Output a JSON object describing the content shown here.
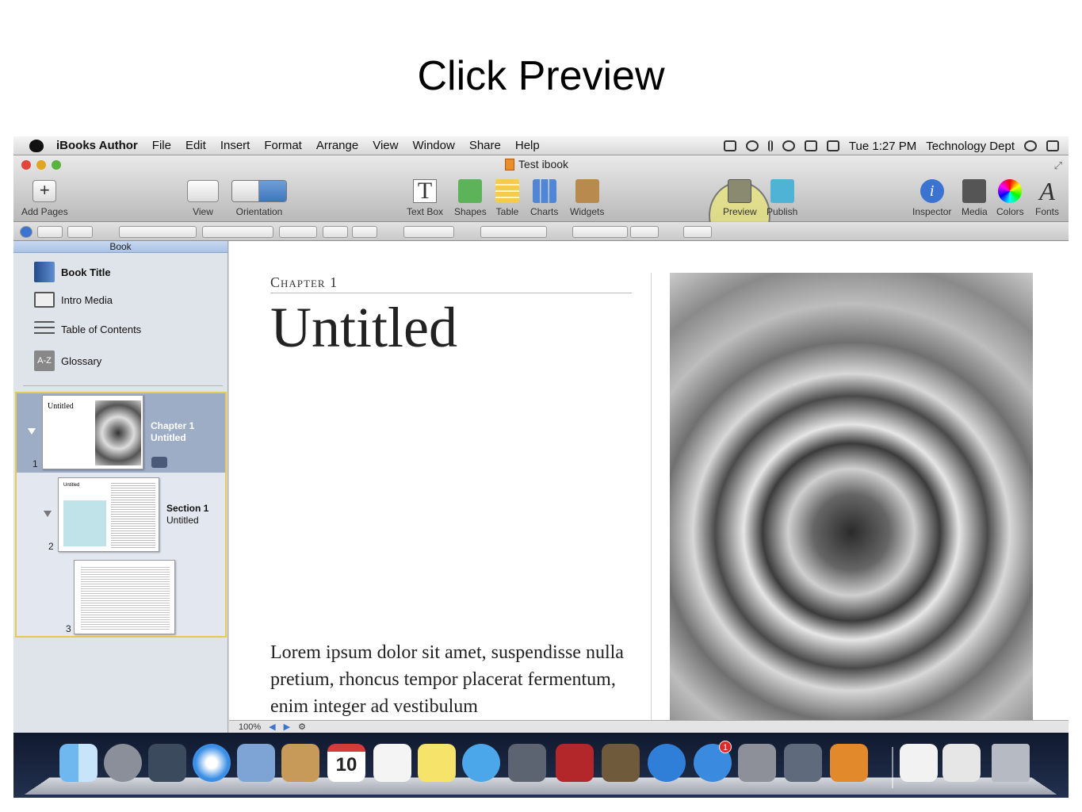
{
  "slide": {
    "title": "Click Preview"
  },
  "menubar": {
    "items": [
      "iBooks Author",
      "File",
      "Edit",
      "Insert",
      "Format",
      "Arrange",
      "View",
      "Window",
      "Share",
      "Help"
    ],
    "clock": "Tue 1:27 PM",
    "user": "Technology Dept"
  },
  "window": {
    "title": "Test ibook"
  },
  "toolbar": {
    "add_pages": "Add Pages",
    "view": "View",
    "orientation": "Orientation",
    "text_box": "Text Box",
    "shapes": "Shapes",
    "table": "Table",
    "charts": "Charts",
    "widgets": "Widgets",
    "preview": "Preview",
    "publish": "Publish",
    "inspector": "Inspector",
    "media": "Media",
    "colors": "Colors",
    "fonts": "Fonts",
    "text_box_glyph": "T",
    "fonts_glyph": "A",
    "add_glyph": "+",
    "inspector_glyph": "i"
  },
  "sidebar": {
    "header": "Book",
    "items": [
      {
        "label": "Book Title",
        "icon": "book-icon"
      },
      {
        "label": "Intro Media",
        "icon": "film-icon"
      },
      {
        "label": "Table of Contents",
        "icon": "list-icon"
      },
      {
        "label": "Glossary",
        "icon": "a-z-icon"
      }
    ],
    "glossary_glyph": "A-Z",
    "pages": [
      {
        "number": "1",
        "title": "Chapter 1",
        "subtitle": "Untitled",
        "thumb_title": "Untitled"
      },
      {
        "number": "2",
        "title": "Section 1",
        "subtitle": "Untitled",
        "thumb_title": "Untitled"
      },
      {
        "number": "3"
      }
    ]
  },
  "document": {
    "chapter_label": "Chapter 1",
    "title": "Untitled",
    "body": "Lorem ipsum dolor sit amet, suspendisse nulla pretium, rhoncus tempor placerat fermentum, enim integer ad vestibulum"
  },
  "statusbar": {
    "zoom": "100%"
  },
  "dock": {
    "badge_count": "1",
    "calendar_day": "10",
    "calendar_month": "DEC",
    "apps": [
      "finder",
      "launchpad",
      "photo-browser",
      "safari",
      "mail",
      "contacts",
      "calendar",
      "reminders",
      "notes",
      "messages",
      "facetime",
      "photo-booth",
      "iphoto",
      "itunes",
      "app-store",
      "system-preferences",
      "keynote",
      "ibooks-author",
      "document",
      "preview",
      "trash"
    ]
  },
  "colors": {
    "highlight": "#e8e478",
    "selection": "#9eadc6",
    "accent": "#3c73bb"
  }
}
